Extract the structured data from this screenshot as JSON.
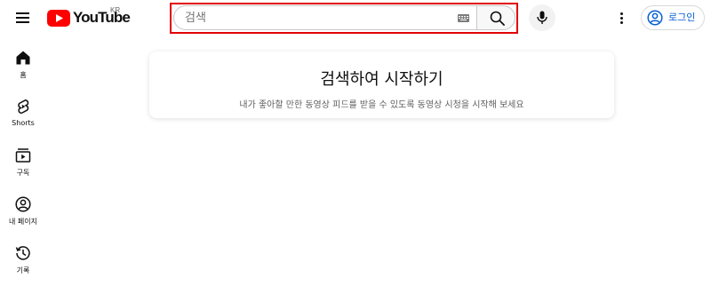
{
  "header": {
    "menu_icon": "hamburger-menu-icon",
    "logo_text": "YouTube",
    "logo_country": "KR",
    "logo_color": "#ff0000",
    "search_placeholder": "검색",
    "keyboard_icon": "keyboard-icon",
    "search_icon": "search-icon",
    "mic_icon": "microphone-icon",
    "more_icon": "more-vertical-icon",
    "login_label": "로그인",
    "login_icon": "account-circle-icon",
    "accent_color": "#065fd4",
    "highlight_color": "#e00000"
  },
  "guide": {
    "items": [
      {
        "label": "홈",
        "icon": "home-icon"
      },
      {
        "label": "Shorts",
        "icon": "shorts-icon"
      },
      {
        "label": "구독",
        "icon": "subscriptions-icon"
      },
      {
        "label": "내 페이지",
        "icon": "account-icon"
      },
      {
        "label": "기록",
        "icon": "history-icon"
      }
    ]
  },
  "main": {
    "prompt_title": "검색하여 시작하기",
    "prompt_subtitle": "내가 좋아할 만한 동영상 피드를 받을 수 있도록 동영상 시청을 시작해 보세요"
  }
}
